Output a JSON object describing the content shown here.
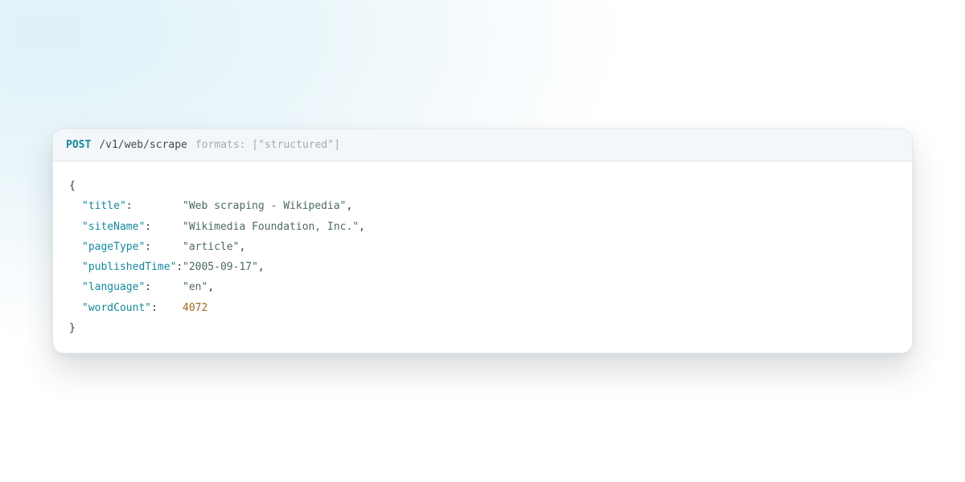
{
  "request": {
    "method": "POST",
    "path": "/v1/web/scrape",
    "hint": "formats: [\"structured\"]"
  },
  "response": {
    "open_brace": "{",
    "close_brace": "}",
    "entries": [
      {
        "key": "\"title\"",
        "value": "\"Web scraping - Wikipedia\"",
        "type": "string"
      },
      {
        "key": "\"siteName\"",
        "value": "\"Wikimedia Foundation, Inc.\"",
        "type": "string"
      },
      {
        "key": "\"pageType\"",
        "value": "\"article\"",
        "type": "string"
      },
      {
        "key": "\"publishedTime\"",
        "value": "\"2005-09-17\"",
        "type": "string"
      },
      {
        "key": "\"language\"",
        "value": "\"en\"",
        "type": "string"
      },
      {
        "key": "\"wordCount\"",
        "value": "4072",
        "type": "number"
      }
    ]
  },
  "colors": {
    "method": "#14899e",
    "key": "#16889b",
    "string": "#4d6b5e",
    "number": "#a0671e"
  }
}
